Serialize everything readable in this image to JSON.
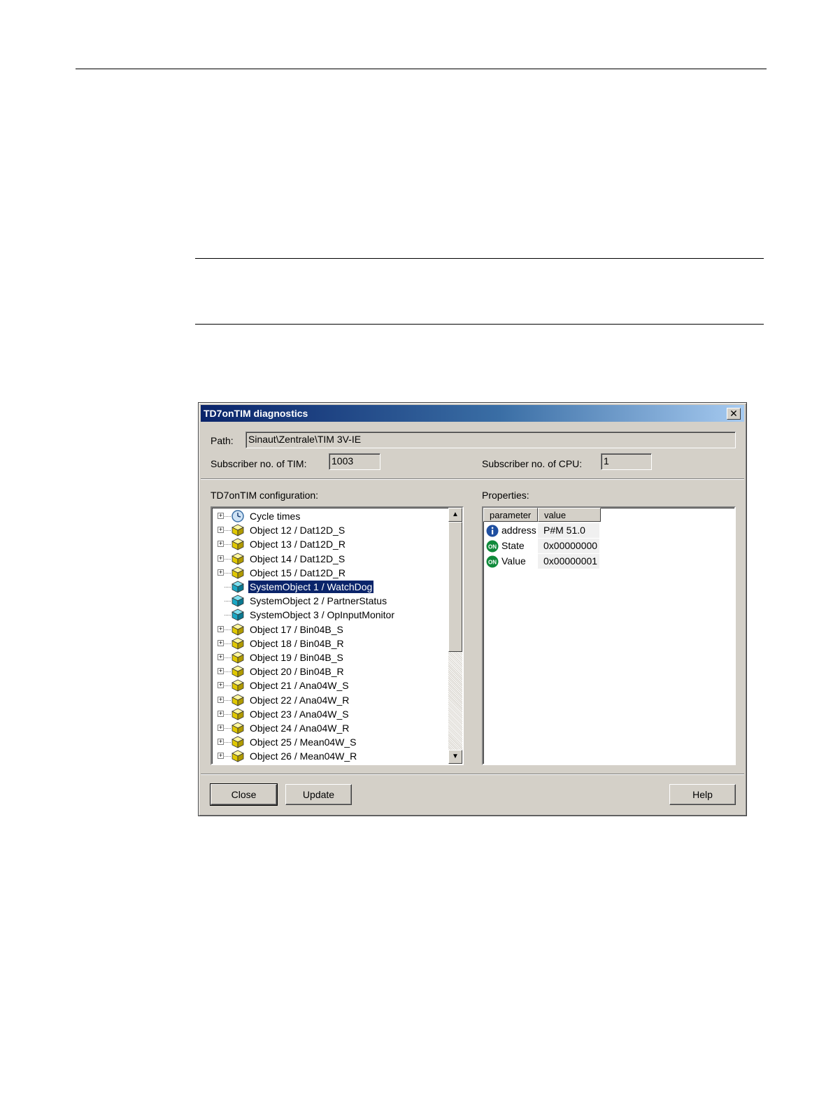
{
  "dialog": {
    "title": "TD7onTIM diagnostics",
    "close_glyph": "✕",
    "path_label": "Path:",
    "path_value": "Sinaut\\Zentrale\\TIM 3V-IE",
    "subscriber_tim_label": "Subscriber no. of TIM:",
    "subscriber_tim_value": "1003",
    "subscriber_cpu_label": "Subscriber no. of CPU:",
    "subscriber_cpu_value": "1",
    "config_label": "TD7onTIM configuration:",
    "properties_label": "Properties:",
    "tree": [
      {
        "label": "Cycle times",
        "icon": "clock-icon",
        "expandable": true,
        "selected": false
      },
      {
        "label": "Object 12 / Dat12D_S",
        "icon": "yellow-cube-icon",
        "expandable": true,
        "selected": false
      },
      {
        "label": "Object 13 / Dat12D_R",
        "icon": "yellow-cube-icon",
        "expandable": true,
        "selected": false
      },
      {
        "label": "Object 14 / Dat12D_S",
        "icon": "yellow-cube-icon",
        "expandable": true,
        "selected": false
      },
      {
        "label": "Object 15 / Dat12D_R",
        "icon": "yellow-cube-icon",
        "expandable": true,
        "selected": false
      },
      {
        "label": "SystemObject 1 / WatchDog",
        "icon": "teal-cube-icon",
        "expandable": false,
        "selected": true
      },
      {
        "label": "SystemObject 2 / PartnerStatus",
        "icon": "teal-cube-icon",
        "expandable": false,
        "selected": false
      },
      {
        "label": "SystemObject 3 / OpInputMonitor",
        "icon": "teal-cube-icon",
        "expandable": false,
        "selected": false
      },
      {
        "label": "Object 17 / Bin04B_S",
        "icon": "yellow-cube-icon",
        "expandable": true,
        "selected": false
      },
      {
        "label": "Object 18 / Bin04B_R",
        "icon": "yellow-cube-icon",
        "expandable": true,
        "selected": false
      },
      {
        "label": "Object 19 / Bin04B_S",
        "icon": "yellow-cube-icon",
        "expandable": true,
        "selected": false
      },
      {
        "label": "Object 20 / Bin04B_R",
        "icon": "yellow-cube-icon",
        "expandable": true,
        "selected": false
      },
      {
        "label": "Object 21 / Ana04W_S",
        "icon": "yellow-cube-icon",
        "expandable": true,
        "selected": false
      },
      {
        "label": "Object 22 / Ana04W_R",
        "icon": "yellow-cube-icon",
        "expandable": true,
        "selected": false
      },
      {
        "label": "Object 23 / Ana04W_S",
        "icon": "yellow-cube-icon",
        "expandable": true,
        "selected": false
      },
      {
        "label": "Object 24 / Ana04W_R",
        "icon": "yellow-cube-icon",
        "expandable": true,
        "selected": false
      },
      {
        "label": "Object 25 / Mean04W_S",
        "icon": "yellow-cube-icon",
        "expandable": true,
        "selected": false
      },
      {
        "label": "Object 26 / Mean04W_R",
        "icon": "yellow-cube-icon",
        "expandable": true,
        "selected": false
      }
    ],
    "properties": {
      "columns": [
        "parameter",
        "value"
      ],
      "rows": [
        {
          "icon": "info-icon",
          "parameter": "address",
          "value": "P#M 51.0"
        },
        {
          "icon": "on-status-icon",
          "parameter": "State",
          "value": "0x00000000"
        },
        {
          "icon": "on-status-icon",
          "parameter": "Value",
          "value": "0x00000001"
        }
      ]
    },
    "buttons": {
      "close": "Close",
      "update": "Update",
      "help": "Help"
    }
  },
  "colors": {
    "titlebar_start": "#0a246a",
    "titlebar_end": "#a6caf0",
    "dialog_face": "#d4d0c8",
    "selection": "#0a246a"
  }
}
